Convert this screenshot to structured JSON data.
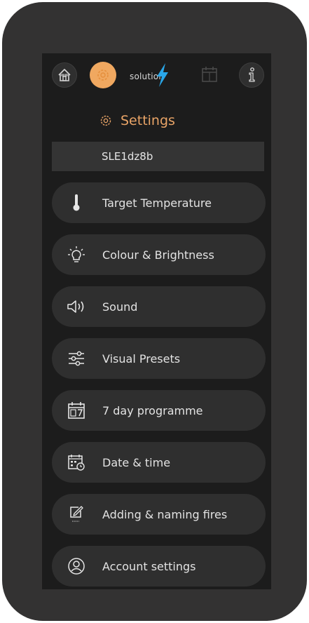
{
  "topbar": {
    "logo_text": "solution",
    "icons": [
      "home-icon",
      "settings-gear-icon",
      "lightning-bolt-icon",
      "calendar-icon",
      "info-icon"
    ]
  },
  "page": {
    "title": "Settings",
    "title_icon": "gear-icon",
    "device_name": "SLE1dz8b"
  },
  "menu": [
    {
      "label": "Target Temperature",
      "icon": "thermometer-icon"
    },
    {
      "label": "Colour & Brightness",
      "icon": "lightbulb-icon"
    },
    {
      "label": "Sound",
      "icon": "speaker-icon"
    },
    {
      "label": "Visual Presets",
      "icon": "sliders-icon"
    },
    {
      "label": "7 day programme",
      "icon": "calendar-7-icon"
    },
    {
      "label": "Date & time",
      "icon": "date-time-icon"
    },
    {
      "label": "Adding & naming fires",
      "icon": "edit-icon"
    },
    {
      "label": "Account settings",
      "icon": "user-account-icon"
    }
  ],
  "colors": {
    "accent": "#f0a860",
    "heading": "#e9a467",
    "background": "#1c1c1c",
    "frame": "#333232",
    "button": "#2f2f2f"
  }
}
